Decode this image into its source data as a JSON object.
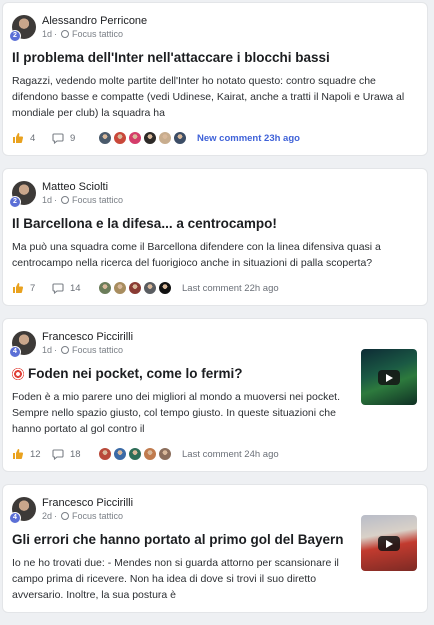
{
  "posts": [
    {
      "author": "Alessandro Perricone",
      "level": "2",
      "age": "1d",
      "category": "Focus tattico",
      "title": "Il problema dell'Inter nell'attaccare i blocchi bassi",
      "body": "Ragazzi, vedendo molte partite dell'Inter ho notato questo: contro squadre che difendono basse e compatte (vedi Udinese, Kairat, anche a tratti il Napoli e Urawa al mondiale per club) la squadra ha",
      "likes": "4",
      "comments": "9",
      "last": "New comment 23h ago",
      "face_colors": [
        "#4a5a6b",
        "#c9483a",
        "#d43c6a",
        "#2d2a28",
        "#c8ad8e",
        "#3c4d66"
      ]
    },
    {
      "author": "Matteo Sciolti",
      "level": "2",
      "age": "1d",
      "category": "Focus tattico",
      "title": "Il Barcellona e la difesa... a centrocampo!",
      "body": "Ma può una squadra come il Barcellona difendere con la linea difensiva quasi a centrocampo nella ricerca del fuorigioco anche in situazioni di palla scoperta?",
      "likes": "7",
      "comments": "14",
      "last": "Last comment 22h ago",
      "face_colors": [
        "#6b7d5a",
        "#a88d5f",
        "#8a3b34",
        "#5a5d61",
        "#111111"
      ]
    },
    {
      "author": "Francesco Piccirilli",
      "level": "4",
      "age": "1d",
      "category": "Focus tattico",
      "title": "Foden nei pocket, come lo fermi?",
      "body": "Foden è a mio parere uno dei migliori al mondo a muoversi nei pocket. Sempre nello spazio giusto, col tempo giusto. In queste situazioni che hanno portato al gol contro il",
      "likes": "12",
      "comments": "18",
      "last": "Last comment 24h ago",
      "face_colors": [
        "#b94a3a",
        "#3b6aa6",
        "#2e6d57",
        "#c07b4e",
        "#8b6e5c"
      ]
    },
    {
      "author": "Francesco Piccirilli",
      "level": "4",
      "age": "2d",
      "category": "Focus tattico",
      "title": "Gli errori che hanno portato al primo gol del Bayern",
      "body": "Io ne ho trovati due: - Mendes non si guarda attorno per scansionare il campo prima di ricevere. Non ha idea di dove si trovi il suo diretto avversario. Inoltre, la sua postura è"
    }
  ],
  "icons": {
    "like": "thumbs-up-icon",
    "comment": "comment-bubble-icon",
    "category": "search-icon",
    "title_badge": "target-icon",
    "video": "play-icon"
  },
  "colors": {
    "accent": "#3f62d8",
    "level_badge": "#5b6fd6"
  }
}
